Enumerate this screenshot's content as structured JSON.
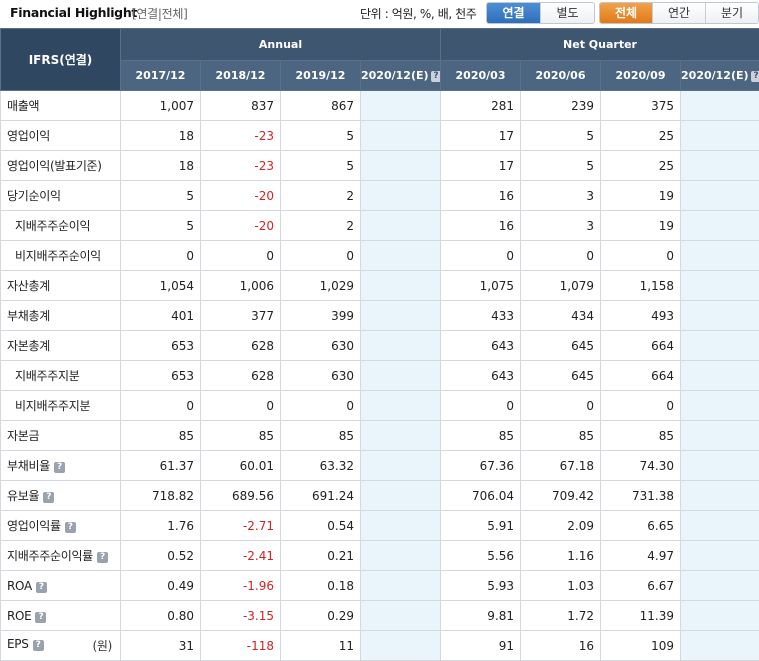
{
  "header": {
    "title": "Financial Highlight",
    "subtitle": "[연결|전체]",
    "unit_label": "단위 : 억원, %, 배, 천주",
    "toggle_consolidation": [
      {
        "label": "연결",
        "active": true
      },
      {
        "label": "별도",
        "active": false
      }
    ],
    "toggle_period": [
      {
        "label": "전체",
        "active": true
      },
      {
        "label": "연간",
        "active": false
      },
      {
        "label": "분기",
        "active": false
      }
    ]
  },
  "table": {
    "corner_label": "IFRS(연결)",
    "groups": [
      {
        "label": "Annual",
        "span": 4
      },
      {
        "label": "Net Quarter",
        "span": 4
      }
    ],
    "columns": [
      {
        "label": "2017/12",
        "estimate": false
      },
      {
        "label": "2018/12",
        "estimate": false
      },
      {
        "label": "2019/12",
        "estimate": false
      },
      {
        "label": "2020/12(E)",
        "estimate": true
      },
      {
        "label": "2020/03",
        "estimate": false
      },
      {
        "label": "2020/06",
        "estimate": false
      },
      {
        "label": "2020/09",
        "estimate": false
      },
      {
        "label": "2020/12(E)",
        "estimate": true
      }
    ],
    "help_glyph": "?",
    "rows": [
      {
        "label": "매출액",
        "indent": false,
        "help": false,
        "unit": "",
        "values": [
          "1,007",
          "837",
          "867",
          "",
          "281",
          "239",
          "375",
          ""
        ]
      },
      {
        "label": "영업이익",
        "indent": false,
        "help": false,
        "unit": "",
        "values": [
          "18",
          "-23",
          "5",
          "",
          "17",
          "5",
          "25",
          ""
        ]
      },
      {
        "label": "영업이익(발표기준)",
        "indent": false,
        "help": false,
        "unit": "",
        "values": [
          "18",
          "-23",
          "5",
          "",
          "17",
          "5",
          "25",
          ""
        ]
      },
      {
        "label": "당기순이익",
        "indent": false,
        "help": false,
        "unit": "",
        "values": [
          "5",
          "-20",
          "2",
          "",
          "16",
          "3",
          "19",
          ""
        ]
      },
      {
        "label": "지배주주순이익",
        "indent": true,
        "help": false,
        "unit": "",
        "values": [
          "5",
          "-20",
          "2",
          "",
          "16",
          "3",
          "19",
          ""
        ]
      },
      {
        "label": "비지배주주순이익",
        "indent": true,
        "help": false,
        "unit": "",
        "values": [
          "0",
          "0",
          "0",
          "",
          "0",
          "0",
          "0",
          ""
        ]
      },
      {
        "label": "자산총계",
        "indent": false,
        "help": false,
        "unit": "",
        "values": [
          "1,054",
          "1,006",
          "1,029",
          "",
          "1,075",
          "1,079",
          "1,158",
          ""
        ]
      },
      {
        "label": "부채총계",
        "indent": false,
        "help": false,
        "unit": "",
        "values": [
          "401",
          "377",
          "399",
          "",
          "433",
          "434",
          "493",
          ""
        ]
      },
      {
        "label": "자본총계",
        "indent": false,
        "help": false,
        "unit": "",
        "values": [
          "653",
          "628",
          "630",
          "",
          "643",
          "645",
          "664",
          ""
        ]
      },
      {
        "label": "지배주주지분",
        "indent": true,
        "help": false,
        "unit": "",
        "values": [
          "653",
          "628",
          "630",
          "",
          "643",
          "645",
          "664",
          ""
        ]
      },
      {
        "label": "비지배주주지분",
        "indent": true,
        "help": false,
        "unit": "",
        "values": [
          "0",
          "0",
          "0",
          "",
          "0",
          "0",
          "0",
          ""
        ]
      },
      {
        "label": "자본금",
        "indent": false,
        "help": false,
        "unit": "",
        "values": [
          "85",
          "85",
          "85",
          "",
          "85",
          "85",
          "85",
          ""
        ]
      },
      {
        "label": "부채비율",
        "indent": false,
        "help": true,
        "unit": "",
        "values": [
          "61.37",
          "60.01",
          "63.32",
          "",
          "67.36",
          "67.18",
          "74.30",
          ""
        ]
      },
      {
        "label": "유보율",
        "indent": false,
        "help": true,
        "unit": "",
        "values": [
          "718.82",
          "689.56",
          "691.24",
          "",
          "706.04",
          "709.42",
          "731.38",
          ""
        ]
      },
      {
        "label": "영업이익률",
        "indent": false,
        "help": true,
        "unit": "",
        "values": [
          "1.76",
          "-2.71",
          "0.54",
          "",
          "5.91",
          "2.09",
          "6.65",
          ""
        ]
      },
      {
        "label": "지배주주순이익률",
        "indent": false,
        "help": true,
        "unit": "",
        "values": [
          "0.52",
          "-2.41",
          "0.21",
          "",
          "5.56",
          "1.16",
          "4.97",
          ""
        ]
      },
      {
        "label": "ROA",
        "indent": false,
        "help": true,
        "unit": "",
        "values": [
          "0.49",
          "-1.96",
          "0.18",
          "",
          "5.93",
          "1.03",
          "6.67",
          ""
        ]
      },
      {
        "label": "ROE",
        "indent": false,
        "help": true,
        "unit": "",
        "values": [
          "0.80",
          "-3.15",
          "0.29",
          "",
          "9.81",
          "1.72",
          "11.39",
          ""
        ]
      },
      {
        "label": "EPS",
        "indent": false,
        "help": true,
        "unit": "(원)",
        "values": [
          "31",
          "-118",
          "11",
          "",
          "91",
          "16",
          "109",
          ""
        ]
      }
    ]
  },
  "colors": {
    "header_bg": "#3e5670",
    "negative": "#d32323",
    "estimate_bg": "#e9f5fb",
    "active_blue": "#2f6fba",
    "active_orange": "#e17a17"
  },
  "icons": {
    "help": "question-help-icon"
  }
}
